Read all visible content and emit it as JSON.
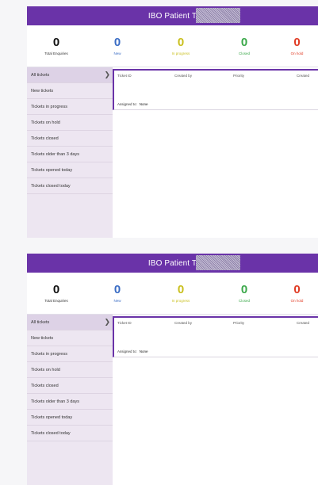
{
  "app": {
    "title": "IBO Patient T"
  },
  "stats": {
    "total": {
      "value": "0",
      "label": "Total Enquiries"
    },
    "new": {
      "value": "0",
      "label": "New"
    },
    "in_progress": {
      "value": "0",
      "label": "In progress"
    },
    "closed": {
      "value": "0",
      "label": "Closed"
    },
    "on_hold": {
      "value": "0",
      "label": "On hold"
    }
  },
  "colors": {
    "header": "#6a33a8",
    "new": "#3a6cc4",
    "in_progress": "#c9bf1c",
    "closed": "#3ba84a",
    "on_hold": "#e03b24"
  },
  "sidebar": {
    "items": [
      {
        "label": "All tickets",
        "active": true
      },
      {
        "label": "New tickets"
      },
      {
        "label": "Tickets in progress"
      },
      {
        "label": "Tickets on hold"
      },
      {
        "label": "Tickets closed"
      },
      {
        "label": "Tickets older than 3 days"
      },
      {
        "label": "Tickets opened today"
      },
      {
        "label": "Tickets closed today"
      }
    ],
    "chevron_icon": "chevron-right-icon"
  },
  "ticket": {
    "col_ticket_id": "Ticket ID",
    "col_created_by": "Created by",
    "col_priority": "Priority",
    "col_created": "Created",
    "assigned_label": "Assigned to:",
    "assigned_value": "None"
  }
}
